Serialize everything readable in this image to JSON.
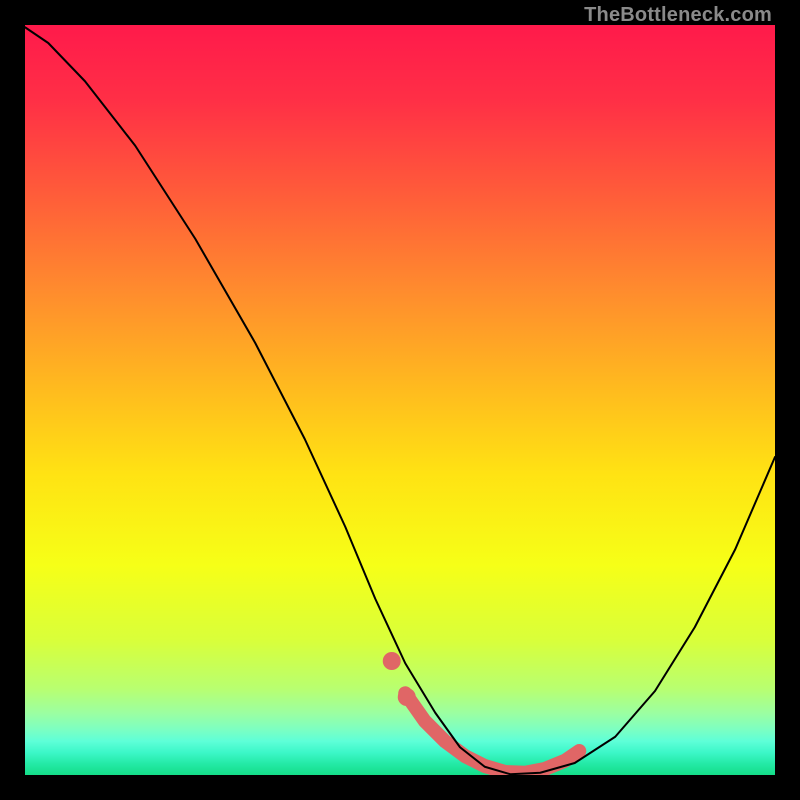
{
  "watermark": "TheBottleneck.com",
  "chart_data": {
    "type": "line",
    "title": "",
    "xlabel": "",
    "ylabel": "",
    "xlim": [
      0,
      100
    ],
    "ylim": [
      0,
      100
    ],
    "grid": false,
    "legend": false,
    "background_gradient_stops": [
      {
        "offset": 0.0,
        "color": "#ff1a4b"
      },
      {
        "offset": 0.1,
        "color": "#ff2f46"
      },
      {
        "offset": 0.22,
        "color": "#ff5a3a"
      },
      {
        "offset": 0.35,
        "color": "#ff8a2e"
      },
      {
        "offset": 0.48,
        "color": "#ffb91f"
      },
      {
        "offset": 0.6,
        "color": "#ffe313"
      },
      {
        "offset": 0.72,
        "color": "#f6ff17"
      },
      {
        "offset": 0.82,
        "color": "#d9ff3a"
      },
      {
        "offset": 0.885,
        "color": "#b8ff70"
      },
      {
        "offset": 0.917,
        "color": "#9cffa0"
      },
      {
        "offset": 0.938,
        "color": "#7effc0"
      },
      {
        "offset": 0.955,
        "color": "#5effd8"
      },
      {
        "offset": 0.97,
        "color": "#3cf7c8"
      },
      {
        "offset": 0.985,
        "color": "#24eaa6"
      },
      {
        "offset": 1.0,
        "color": "#14dd88"
      }
    ],
    "series": [
      {
        "name": "bottleneck-curve",
        "color": "#000000",
        "stroke_width": 2,
        "x": [
          0.0,
          3.1,
          8.0,
          14.7,
          22.7,
          30.7,
          37.3,
          42.7,
          46.7,
          50.7,
          54.7,
          58.0,
          61.3,
          64.7,
          68.7,
          73.3,
          78.7,
          84.0,
          89.3,
          94.7,
          100.0
        ],
        "y": [
          99.7,
          97.6,
          92.5,
          83.9,
          71.5,
          57.6,
          44.8,
          33.1,
          23.5,
          14.9,
          8.3,
          3.7,
          1.1,
          0.1,
          0.3,
          1.6,
          5.1,
          11.2,
          19.7,
          30.1,
          42.4
        ]
      }
    ],
    "highlight_segment": {
      "name": "flat-minimum-highlight",
      "color": "#e06666",
      "stroke_width": 14,
      "x": [
        50.7,
        53.3,
        56.0,
        58.7,
        61.3,
        64.0,
        66.7,
        69.3,
        72.0,
        73.9
      ],
      "y": [
        10.9,
        7.2,
        4.5,
        2.5,
        1.2,
        0.4,
        0.3,
        0.8,
        1.9,
        3.2
      ]
    },
    "highlight_dots": {
      "name": "flat-minimum-caps",
      "color": "#e06666",
      "radius": 9,
      "points": [
        {
          "x": 48.9,
          "y": 15.2
        },
        {
          "x": 50.9,
          "y": 10.4
        }
      ]
    }
  }
}
